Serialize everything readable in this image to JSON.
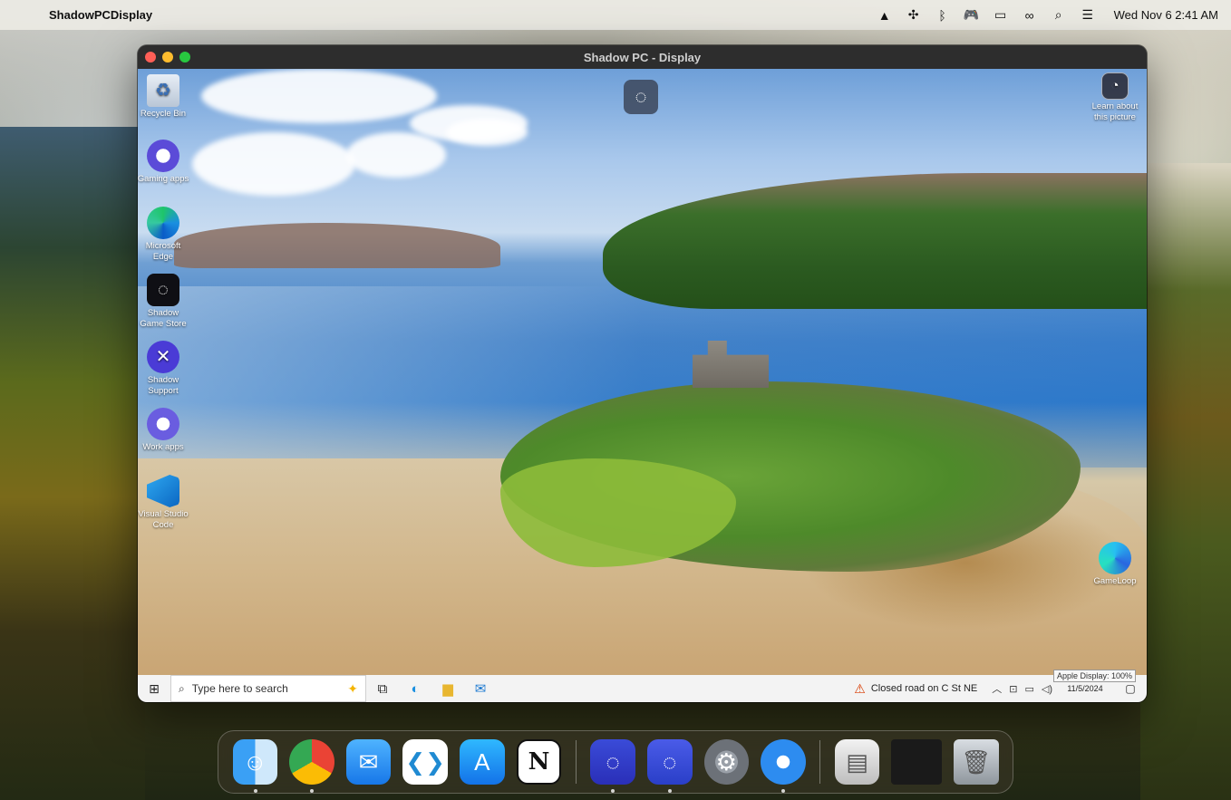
{
  "menubar": {
    "app_name": "ShadowPCDisplay",
    "clock": "Wed Nov 6  2:41 AM",
    "icons": [
      "shadow-app-icon",
      "controls-icon",
      "bluetooth-icon",
      "gamepad-icon",
      "battery-icon",
      "link-icon",
      "search-icon",
      "control-center-icon"
    ]
  },
  "window": {
    "title": "Shadow PC - Display"
  },
  "desktop_icons": [
    {
      "label": "Recycle Bin",
      "icon": "recycle-bin-icon"
    },
    {
      "label": "Gaming apps",
      "icon": "gaming-apps-icon"
    },
    {
      "label": "Microsoft Edge",
      "icon": "edge-icon"
    },
    {
      "label": "Shadow Game Store",
      "icon": "shadow-game-store-icon"
    },
    {
      "label": "Shadow Support",
      "icon": "shadow-support-icon"
    },
    {
      "label": "Work apps",
      "icon": "work-apps-icon"
    },
    {
      "label": "Visual Studio Code",
      "icon": "vscode-icon"
    },
    {
      "label": "GameLoop",
      "icon": "gameloop-icon"
    },
    {
      "label": "Learn about this picture",
      "icon": "learn-picture-icon"
    }
  ],
  "taskbar": {
    "search_placeholder": "Type here to search",
    "news": "Closed road on C St NE",
    "date": "11/5/2024",
    "tooltip": "Apple Display: 100%"
  },
  "dock": {
    "apps": [
      "finder-icon",
      "chrome-icon",
      "mail-icon",
      "vscode-icon",
      "app-store-icon",
      "notion-icon",
      "shadow-icon",
      "shadow-pc-icon",
      "system-settings-icon",
      "safari-icon",
      "disk-image-icon",
      "window-preview-icon",
      "trash-icon"
    ],
    "notion_glyph": "N"
  }
}
